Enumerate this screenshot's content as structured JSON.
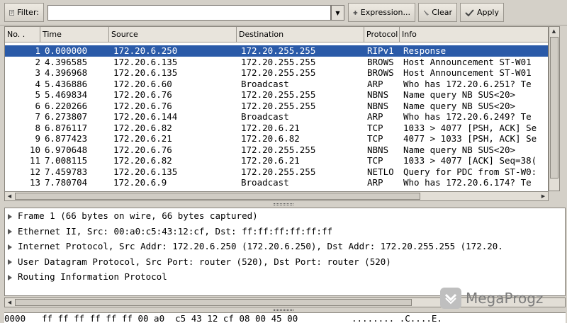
{
  "toolbar": {
    "filter_label": "Filter:",
    "filter_value": "",
    "expression_label": "Expression...",
    "clear_label": "Clear",
    "apply_label": "Apply"
  },
  "packet_list": {
    "columns": [
      "No. .",
      "Time",
      "Source",
      "Destination",
      "Protocol",
      "Info"
    ],
    "selected_row": 0,
    "rows": [
      {
        "no": "1",
        "time": "0.000000",
        "source": "172.20.6.250",
        "destination": "172.20.255.255",
        "protocol": "RIPv1",
        "info": "Response"
      },
      {
        "no": "2",
        "time": "4.396585",
        "source": "172.20.6.135",
        "destination": "172.20.255.255",
        "protocol": "BROWS",
        "info": "Host Announcement ST-W01"
      },
      {
        "no": "3",
        "time": "4.396968",
        "source": "172.20.6.135",
        "destination": "172.20.255.255",
        "protocol": "BROWS",
        "info": "Host Announcement ST-W01"
      },
      {
        "no": "4",
        "time": "5.436886",
        "source": "172.20.6.60",
        "destination": "Broadcast",
        "protocol": "ARP",
        "info": "Who has 172.20.6.251?  Te"
      },
      {
        "no": "5",
        "time": "5.469834",
        "source": "172.20.6.76",
        "destination": "172.20.255.255",
        "protocol": "NBNS",
        "info": "Name query NB SUS<20>"
      },
      {
        "no": "6",
        "time": "6.220266",
        "source": "172.20.6.76",
        "destination": "172.20.255.255",
        "protocol": "NBNS",
        "info": "Name query NB SUS<20>"
      },
      {
        "no": "7",
        "time": "6.273807",
        "source": "172.20.6.144",
        "destination": "Broadcast",
        "protocol": "ARP",
        "info": "Who has 172.20.6.249?  Te"
      },
      {
        "no": "8",
        "time": "6.876117",
        "source": "172.20.6.82",
        "destination": "172.20.6.21",
        "protocol": "TCP",
        "info": "1033 > 4077 [PSH, ACK] Se"
      },
      {
        "no": "9",
        "time": "6.877423",
        "source": "172.20.6.21",
        "destination": "172.20.6.82",
        "protocol": "TCP",
        "info": "4077 > 1033 [PSH, ACK] Se"
      },
      {
        "no": "10",
        "time": "6.970648",
        "source": "172.20.6.76",
        "destination": "172.20.255.255",
        "protocol": "NBNS",
        "info": "Name query NB SUS<20>"
      },
      {
        "no": "11",
        "time": "7.008115",
        "source": "172.20.6.82",
        "destination": "172.20.6.21",
        "protocol": "TCP",
        "info": "1033 > 4077 [ACK] Seq=38("
      },
      {
        "no": "12",
        "time": "7.459783",
        "source": "172.20.6.135",
        "destination": "172.20.255.255",
        "protocol": "NETLO",
        "info": "Query for PDC from ST-W0:"
      },
      {
        "no": "13",
        "time": "7.780704",
        "source": "172.20.6.9",
        "destination": "Broadcast",
        "protocol": "ARP",
        "info": "Who has 172.20.6.174?  Te"
      }
    ]
  },
  "details": [
    "Frame 1 (66 bytes on wire, 66 bytes captured)",
    "Ethernet II, Src: 00:a0:c5:43:12:cf, Dst: ff:ff:ff:ff:ff:ff",
    "Internet Protocol, Src Addr: 172.20.6.250 (172.20.6.250), Dst Addr: 172.20.255.255 (172.20.",
    "User Datagram Protocol, Src Port: router (520), Dst Port: router (520)",
    "Routing Information Protocol"
  ],
  "bytes": {
    "offset": "0000",
    "hex": "ff ff ff ff ff ff 00 a0  c5 43 12 cf 08 00 45 00",
    "ascii": "........ .C....E."
  },
  "watermark": {
    "text": "MegaProgz"
  }
}
